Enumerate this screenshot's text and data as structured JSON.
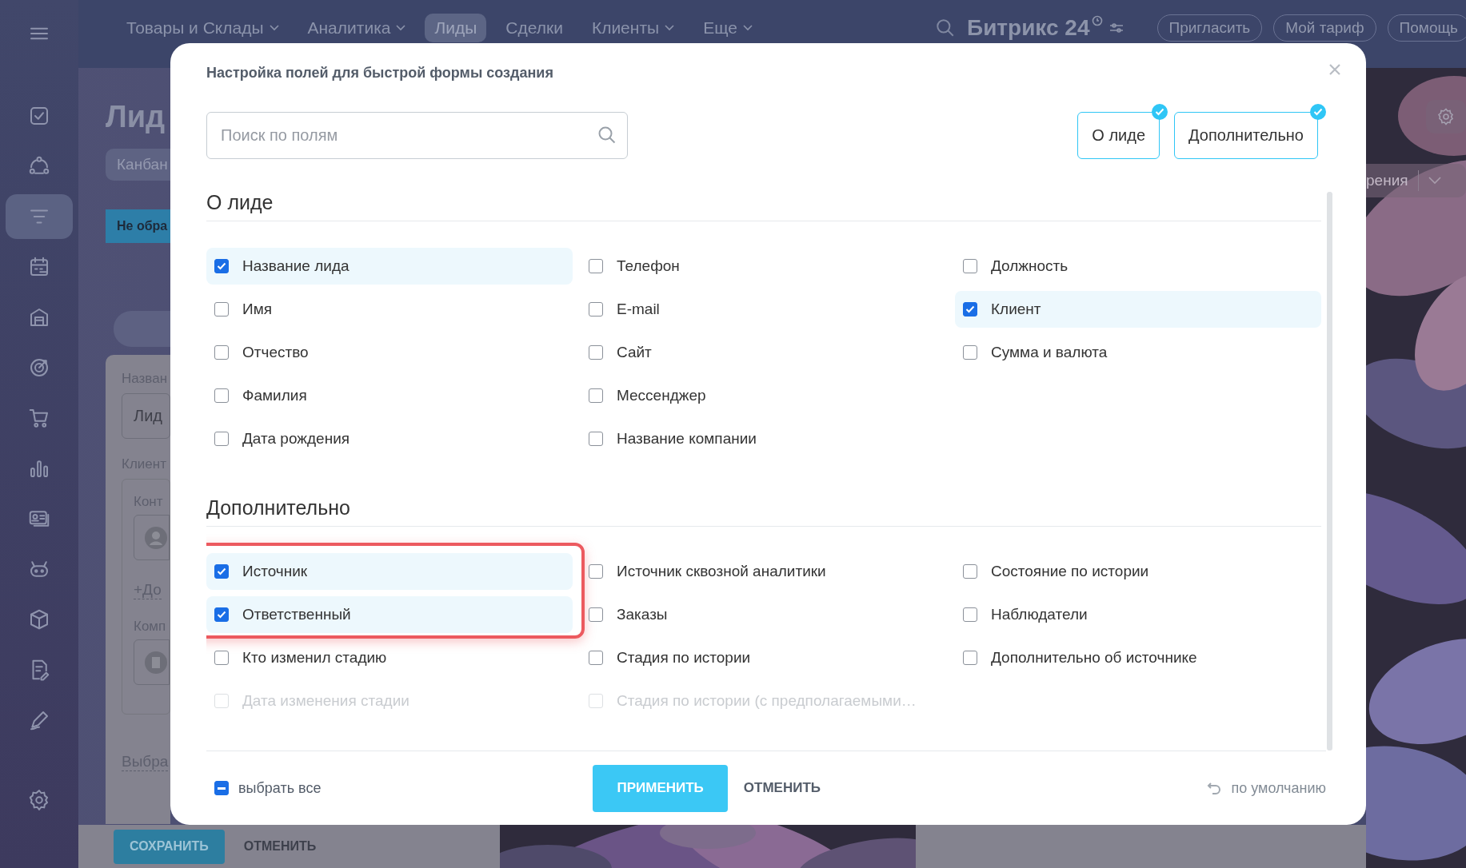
{
  "sidebar": {
    "items": [
      {
        "selected": false
      },
      {
        "selected": false
      },
      {
        "selected": true
      },
      {
        "selected": false
      },
      {
        "selected": false
      },
      {
        "selected": false
      },
      {
        "selected": false
      },
      {
        "selected": false
      },
      {
        "selected": false
      },
      {
        "selected": false
      },
      {
        "selected": false
      },
      {
        "selected": false
      },
      {
        "selected": false
      },
      {
        "selected": false
      }
    ]
  },
  "topbar": {
    "nav": [
      {
        "label": "Товары и Склады",
        "has_menu": true,
        "selected": false
      },
      {
        "label": "Аналитика",
        "has_menu": true,
        "selected": false
      },
      {
        "label": "Лиды",
        "has_menu": false,
        "selected": true
      },
      {
        "label": "Сделки",
        "has_menu": false,
        "selected": false
      },
      {
        "label": "Клиенты",
        "has_menu": true,
        "selected": false
      },
      {
        "label": "Еще",
        "has_menu": true,
        "selected": false
      }
    ],
    "logo": "Битрикс 24",
    "buttons": [
      "Пригласить",
      "Мой тариф",
      "Помощь"
    ]
  },
  "page": {
    "title": "Лид",
    "view": "Канбан",
    "column": "Не обра",
    "form": {
      "name_label": "Назван",
      "name_placeholder": "Лид",
      "client_label": "Клиент",
      "contact_label": "Конт",
      "add_link": "+До",
      "company_label": "Комп",
      "choose_link": "Выбра"
    },
    "save": "СОХРАНИТЬ",
    "cancel": "ОТМЕНИТЬ",
    "right_menu": "рения"
  },
  "dialog": {
    "title": "Настройка полей для быстрой формы создания",
    "search": {
      "placeholder": "Поиск по полям"
    },
    "section_buttons": [
      {
        "label": "О лиде",
        "selected": true
      },
      {
        "label": "Дополнительно",
        "selected": true
      }
    ],
    "sections": [
      {
        "title": "О лиде",
        "items": [
          {
            "label": "Название лида",
            "checked": true,
            "annotated": false
          },
          {
            "label": "Имя",
            "checked": false,
            "annotated": false
          },
          {
            "label": "Отчество",
            "checked": false,
            "annotated": false
          },
          {
            "label": "Фамилия",
            "checked": false,
            "annotated": false
          },
          {
            "label": "Дата рождения",
            "checked": false,
            "annotated": false
          },
          {
            "label": "Телефон",
            "checked": false,
            "annotated": false
          },
          {
            "label": "E-mail",
            "checked": false,
            "annotated": false
          },
          {
            "label": "Сайт",
            "checked": false,
            "annotated": false
          },
          {
            "label": "Мессенджер",
            "checked": false,
            "annotated": false
          },
          {
            "label": "Название компании",
            "checked": false,
            "annotated": false
          },
          {
            "label": "Должность",
            "checked": false,
            "annotated": false
          },
          {
            "label": "Клиент",
            "checked": true,
            "annotated": false
          },
          {
            "label": "Сумма и валюта",
            "checked": false,
            "annotated": false
          }
        ]
      },
      {
        "title": "Дополнительно",
        "items": [
          {
            "label": "Источник",
            "checked": true,
            "annotated": true
          },
          {
            "label": "Ответственный",
            "checked": true,
            "annotated": true
          },
          {
            "label": "Кто изменил стадию",
            "checked": false,
            "annotated": false
          },
          {
            "label": "Дата изменения стадии",
            "checked": false,
            "annotated": false
          },
          {
            "label": "Источник сквозной аналитики",
            "checked": false,
            "annotated": false
          },
          {
            "label": "Заказы",
            "checked": false,
            "annotated": false
          },
          {
            "label": "Стадия по истории",
            "checked": false,
            "annotated": false
          },
          {
            "label": "Стадия по истории (с предполагаемыми…",
            "checked": false,
            "annotated": false
          },
          {
            "label": "Состояние по истории",
            "checked": false,
            "annotated": false
          },
          {
            "label": "Наблюдатели",
            "checked": false,
            "annotated": false
          },
          {
            "label": "Дополнительно об источнике",
            "checked": false,
            "annotated": false
          }
        ]
      }
    ],
    "select_all": {
      "label": "выбрать все",
      "indeterminate": true
    },
    "apply": "ПРИМЕНИТЬ",
    "cancel": "ОТМЕНИТЬ",
    "reset": "по умолчанию"
  }
}
